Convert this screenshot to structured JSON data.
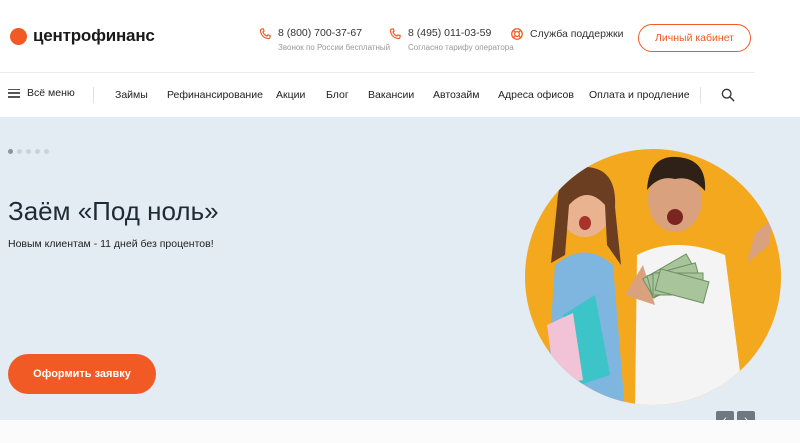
{
  "brand": {
    "name": "центрофинанс",
    "color": "#f15a24"
  },
  "contacts": {
    "phone1": {
      "number": "8 (800) 700-37-67",
      "note": "Звонок по России бесплатный",
      "icon": "phone-icon"
    },
    "phone2": {
      "number": "8 (495) 011-03-59",
      "note": "Согласно тарифу оператора",
      "icon": "phone-icon"
    },
    "support": {
      "label": "Служба поддержки",
      "icon": "lifebuoy-icon"
    }
  },
  "cabinet_label": "Личный кабинет",
  "nav": {
    "menu_all": "Всё меню",
    "items": [
      "Займы",
      "Рефинансирование",
      "Акции",
      "Блог",
      "Вакансии",
      "Автозайм",
      "Адреса офисов",
      "Оплата и продление"
    ]
  },
  "banner": {
    "title": "Заём «Под ноль»",
    "subtitle": "Новым клиентам - 11 дней без процентов!",
    "cta": "Оформить заявку",
    "slides_total": 5,
    "slide_active": 1,
    "prev": "‹",
    "next": "›"
  },
  "colors": {
    "accent": "#f15a24",
    "banner_bg": "#e3ebf3",
    "hero_circle": "#f4a81d"
  }
}
